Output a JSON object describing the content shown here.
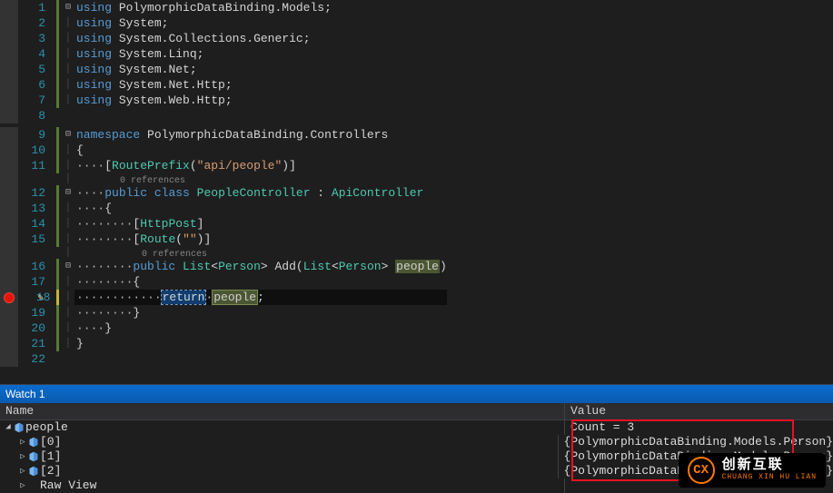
{
  "code": {
    "lines": [
      {
        "n": 1,
        "mark": "green",
        "fold": "⊟",
        "tokens": [
          [
            "kw",
            "using"
          ],
          [
            "id",
            " PolymorphicDataBinding"
          ],
          [
            "pun",
            "."
          ],
          [
            "id",
            "Models"
          ],
          [
            "pun",
            ";"
          ]
        ]
      },
      {
        "n": 2,
        "mark": "green",
        "fold": "│",
        "tokens": [
          [
            "kw",
            "using"
          ],
          [
            "id",
            " System"
          ],
          [
            "pun",
            ";"
          ]
        ]
      },
      {
        "n": 3,
        "mark": "green",
        "fold": "│",
        "tokens": [
          [
            "kw",
            "using"
          ],
          [
            "id",
            " System"
          ],
          [
            "pun",
            "."
          ],
          [
            "id",
            "Collections"
          ],
          [
            "pun",
            "."
          ],
          [
            "id",
            "Generic"
          ],
          [
            "pun",
            ";"
          ]
        ]
      },
      {
        "n": 4,
        "mark": "green",
        "fold": "│",
        "tokens": [
          [
            "kw",
            "using"
          ],
          [
            "id",
            " System"
          ],
          [
            "pun",
            "."
          ],
          [
            "id",
            "Linq"
          ],
          [
            "pun",
            ";"
          ]
        ]
      },
      {
        "n": 5,
        "mark": "green",
        "fold": "│",
        "tokens": [
          [
            "kw",
            "using"
          ],
          [
            "id",
            " System"
          ],
          [
            "pun",
            "."
          ],
          [
            "id",
            "Net"
          ],
          [
            "pun",
            ";"
          ]
        ]
      },
      {
        "n": 6,
        "mark": "green",
        "fold": "│",
        "tokens": [
          [
            "kw",
            "using"
          ],
          [
            "id",
            " System"
          ],
          [
            "pun",
            "."
          ],
          [
            "id",
            "Net"
          ],
          [
            "pun",
            "."
          ],
          [
            "id",
            "Http"
          ],
          [
            "pun",
            ";"
          ]
        ]
      },
      {
        "n": 7,
        "mark": "green",
        "fold": "│",
        "tokens": [
          [
            "kw",
            "using"
          ],
          [
            "id",
            " System"
          ],
          [
            "pun",
            "."
          ],
          [
            "id",
            "Web"
          ],
          [
            "pun",
            "."
          ],
          [
            "id",
            "Http"
          ],
          [
            "pun",
            ";"
          ]
        ]
      },
      {
        "n": 8,
        "mark": "",
        "fold": "",
        "tokens": []
      },
      {
        "n": 9,
        "mark": "green",
        "fold": "⊟",
        "tokens": [
          [
            "kw",
            "namespace"
          ],
          [
            "id",
            " PolymorphicDataBinding"
          ],
          [
            "pun",
            "."
          ],
          [
            "id",
            "Controllers"
          ]
        ]
      },
      {
        "n": 10,
        "mark": "green",
        "fold": "│",
        "tokens": [
          [
            "pun",
            "{"
          ]
        ]
      },
      {
        "n": 11,
        "mark": "green",
        "fold": "│",
        "tokens": [
          [
            "dot",
            "····"
          ],
          [
            "pun",
            "["
          ],
          [
            "cls",
            "RoutePrefix"
          ],
          [
            "pun",
            "("
          ],
          [
            "str",
            "\"api/people\""
          ],
          [
            "pun",
            ")]"
          ]
        ]
      },
      {
        "n": "",
        "mark": "",
        "fold": "│",
        "hint": "        0 references"
      },
      {
        "n": 12,
        "mark": "green",
        "fold": "⊟",
        "tokens": [
          [
            "dot",
            "····"
          ],
          [
            "kw",
            "public"
          ],
          [
            "id",
            " "
          ],
          [
            "kw",
            "class"
          ],
          [
            "id",
            " "
          ],
          [
            "cls",
            "PeopleController"
          ],
          [
            "id",
            " : "
          ],
          [
            "cls",
            "ApiController"
          ]
        ]
      },
      {
        "n": 13,
        "mark": "green",
        "fold": "│",
        "tokens": [
          [
            "dot",
            "····"
          ],
          [
            "pun",
            "{"
          ]
        ]
      },
      {
        "n": 14,
        "mark": "green",
        "fold": "│",
        "tokens": [
          [
            "dot",
            "········"
          ],
          [
            "pun",
            "["
          ],
          [
            "cls",
            "HttpPost"
          ],
          [
            "pun",
            "]"
          ]
        ]
      },
      {
        "n": 15,
        "mark": "green",
        "fold": "│",
        "tokens": [
          [
            "dot",
            "········"
          ],
          [
            "pun",
            "["
          ],
          [
            "cls",
            "Route"
          ],
          [
            "pun",
            "("
          ],
          [
            "str",
            "\"\""
          ],
          [
            "pun",
            ")]"
          ]
        ]
      },
      {
        "n": "",
        "mark": "",
        "fold": "│",
        "hint": "            0 references"
      },
      {
        "n": 16,
        "mark": "green",
        "fold": "⊟",
        "tokens": [
          [
            "dot",
            "········"
          ],
          [
            "kw",
            "public"
          ],
          [
            "id",
            " "
          ],
          [
            "cls",
            "List"
          ],
          [
            "pun",
            "<"
          ],
          [
            "cls",
            "Person"
          ],
          [
            "pun",
            "> "
          ],
          [
            "id",
            "Add"
          ],
          [
            "pun",
            "("
          ],
          [
            "cls",
            "List"
          ],
          [
            "pun",
            "<"
          ],
          [
            "cls",
            "Person"
          ],
          [
            "pun",
            "> "
          ],
          [
            "hlvar",
            "people"
          ],
          [
            "pun",
            ")"
          ]
        ]
      },
      {
        "n": 17,
        "mark": "green",
        "fold": "│",
        "tokens": [
          [
            "dot",
            "········"
          ],
          [
            "pun",
            "{"
          ]
        ]
      },
      {
        "n": 18,
        "mark": "ygreen",
        "fold": "│",
        "bp": true,
        "active": true,
        "tokens": [
          [
            "dot",
            "············"
          ],
          [
            "retbox",
            "return"
          ],
          [
            "dot",
            "·"
          ],
          [
            "hlvar b",
            "people"
          ],
          [
            "pun",
            ";"
          ]
        ]
      },
      {
        "n": 19,
        "mark": "green",
        "fold": "│",
        "tokens": [
          [
            "dot",
            "········"
          ],
          [
            "pun",
            "}"
          ]
        ]
      },
      {
        "n": 20,
        "mark": "green",
        "fold": "│",
        "tokens": [
          [
            "dot",
            "····"
          ],
          [
            "pun",
            "}"
          ]
        ]
      },
      {
        "n": 21,
        "mark": "green",
        "fold": "│",
        "tokens": [
          [
            "pun",
            "}"
          ]
        ]
      },
      {
        "n": 22,
        "mark": "",
        "fold": "",
        "tokens": []
      }
    ]
  },
  "watch": {
    "title": "Watch 1",
    "columns": {
      "name": "Name",
      "value": "Value"
    },
    "root": {
      "name": "people",
      "value": "Count = 3",
      "expanded": true,
      "children": [
        {
          "name": "[0]",
          "value": "{PolymorphicDataBinding.Models.Person}",
          "expanded": false
        },
        {
          "name": "[1]",
          "value": "{PolymorphicDataBinding.Models.Person}",
          "expanded": false
        },
        {
          "name": "[2]",
          "value": "{PolymorphicDataBinding.Models.Person}",
          "expanded": false
        },
        {
          "name": "Raw View",
          "value": "",
          "expanded": false,
          "icon": "none"
        }
      ]
    }
  },
  "logo": {
    "big": "创新互联",
    "small": "CHUANG XIN HU LIAN",
    "mark": "CX"
  }
}
